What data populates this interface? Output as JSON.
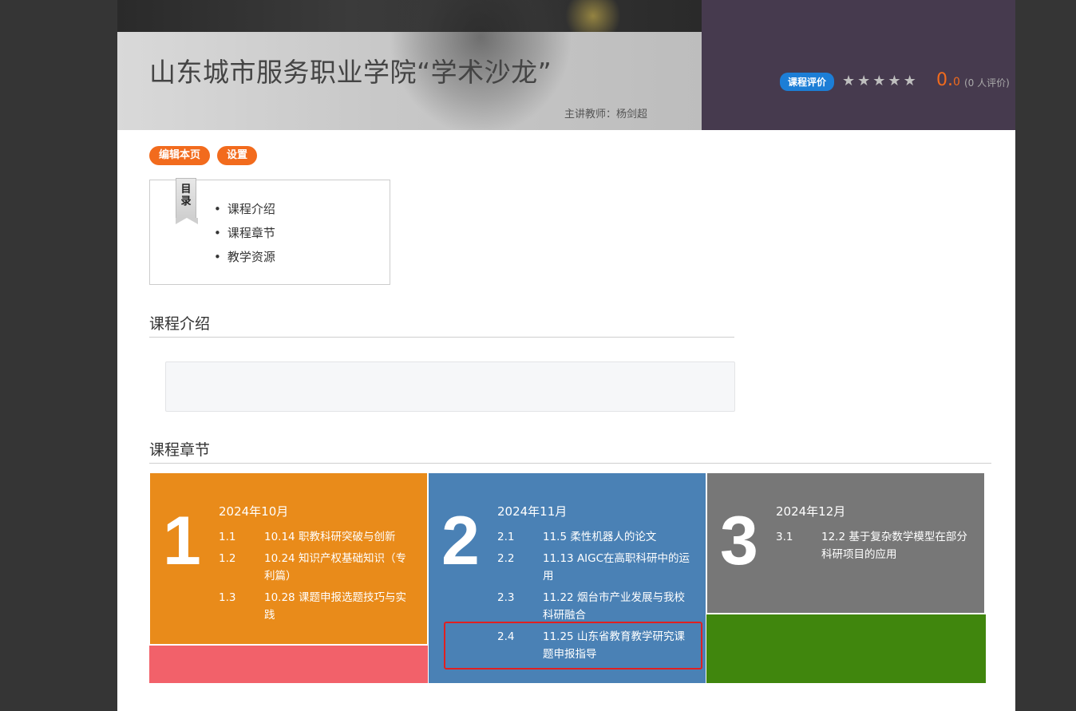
{
  "banner": {
    "title": "山东城市服务职业学院“学术沙龙”",
    "teacher": "主讲教师：杨剑超"
  },
  "rating": {
    "badge": "课程评价",
    "stars": [
      "★",
      "★",
      "★",
      "★",
      "★"
    ],
    "score_int": "0.",
    "score_dec": "0",
    "count": "(0 人评价)"
  },
  "actions": {
    "edit_label": "编辑本页",
    "settings_label": "设置"
  },
  "toc": {
    "ribbon_label": "目录",
    "items": [
      "课程介绍",
      "课程章节",
      "教学资源"
    ]
  },
  "sections": {
    "intro_heading": "课程介绍",
    "chapters_heading": "课程章节"
  },
  "chapters": [
    {
      "number": "1",
      "month": "2024年10月",
      "color": "#e98b1a",
      "lessons": [
        {
          "no": "1.1",
          "title": "10.14 职教科研突破与创新"
        },
        {
          "no": "1.2",
          "title": "10.24 知识产权基础知识（专利篇）"
        },
        {
          "no": "1.3",
          "title": "10.28 课题申报选题技巧与实践"
        }
      ]
    },
    {
      "number": "2",
      "month": "2024年11月",
      "color": "#4a81b5",
      "lessons": [
        {
          "no": "2.1",
          "title": "11.5 柔性机器人的论文"
        },
        {
          "no": "2.2",
          "title": "11.13 AIGC在高职科研中的运用"
        },
        {
          "no": "2.3",
          "title": "11.22 烟台市产业发展与我校科研融合"
        },
        {
          "no": "2.4",
          "title": "11.25 山东省教育教学研究课题申报指导"
        }
      ]
    },
    {
      "number": "3",
      "month": "2024年12月",
      "color": "#777777",
      "lessons": [
        {
          "no": "3.1",
          "title": "12.2 基于复杂数学模型在部分科研项目的应用"
        }
      ]
    }
  ],
  "tile_colors": {
    "pink": "#f2616a",
    "green": "#40860d",
    "accent": "#f26b1d",
    "badge": "#1c7ed6"
  }
}
